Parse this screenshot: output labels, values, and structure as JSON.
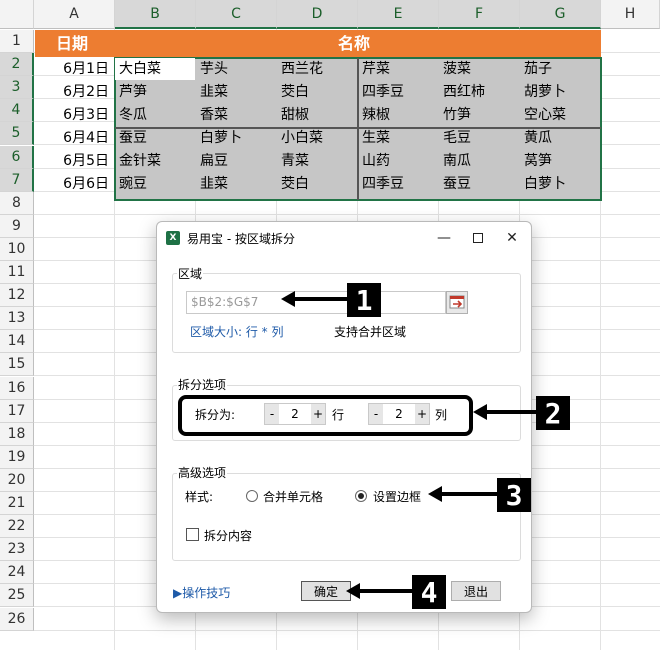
{
  "sheet": {
    "columns": [
      "A",
      "B",
      "C",
      "D",
      "E",
      "F",
      "G",
      "H"
    ],
    "rows": [
      "1",
      "2",
      "3",
      "4",
      "5",
      "6",
      "7",
      "8",
      "9",
      "10",
      "11",
      "12",
      "13",
      "14",
      "15",
      "16",
      "17",
      "18",
      "19",
      "20",
      "21",
      "22",
      "23",
      "24",
      "25",
      "26"
    ],
    "header_date": "日期",
    "header_name": "名称",
    "dates": [
      "6月1日",
      "6月2日",
      "6月3日",
      "6月4日",
      "6月5日",
      "6月6日"
    ],
    "data": [
      [
        "大白菜",
        "芋头",
        "西兰花",
        "芹菜",
        "菠菜",
        "茄子"
      ],
      [
        "芦笋",
        "韭菜",
        "茭白",
        "四季豆",
        "西红柿",
        "胡萝卜"
      ],
      [
        "冬瓜",
        "香菜",
        "甜椒",
        "辣椒",
        "竹笋",
        "空心菜"
      ],
      [
        "蚕豆",
        "白萝卜",
        "小白菜",
        "生菜",
        "毛豆",
        "黄瓜"
      ],
      [
        "金针菜",
        "扁豆",
        "青菜",
        "山药",
        "南瓜",
        "莴笋"
      ],
      [
        "豌豆",
        "韭菜",
        "茭白",
        "四季豆",
        "蚕豆",
        "白萝卜"
      ]
    ],
    "header_color": "#ed7d31",
    "selection_color": "#217346"
  },
  "dialog": {
    "title": "易用宝 - 按区域拆分",
    "app_icon": "X",
    "region_group": "区域",
    "range_value": "$B$2:$G$7",
    "size_label": "区域大小: 行 * 列",
    "merge_support": "支持合并区域",
    "split_group": "拆分选项",
    "split_label": "拆分为:",
    "rows_value": "2",
    "rows_unit": "行",
    "cols_value": "2",
    "cols_unit": "列",
    "minus": "-",
    "plus": "+",
    "advanced_group": "高级选项",
    "style_label": "样式:",
    "opt_merge": "合并单元格",
    "opt_border": "设置边框",
    "selected_option": "设置边框",
    "split_content": "拆分内容",
    "split_content_checked": false,
    "tips_link": "▶操作技巧",
    "ok": "确定",
    "exit": "退出"
  },
  "annotations": [
    "1",
    "2",
    "3",
    "4"
  ]
}
